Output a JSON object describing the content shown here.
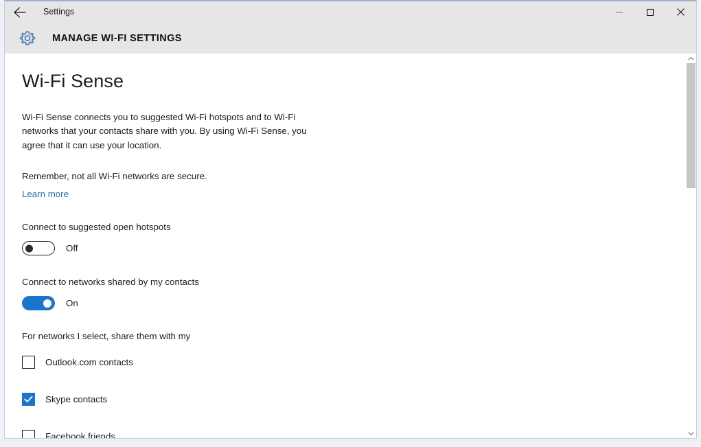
{
  "window": {
    "titlebar": {
      "back_icon": "back-arrow-icon",
      "title": "Settings",
      "minimize_label": "minimize-icon",
      "maximize_label": "maximize-icon",
      "close_label": "close-icon"
    },
    "header": {
      "icon": "gear-icon",
      "title": "MANAGE WI-FI SETTINGS"
    }
  },
  "main": {
    "page_title": "Wi-Fi Sense",
    "description": "Wi-Fi Sense connects you to suggested Wi-Fi hotspots and to Wi-Fi networks that your contacts share with you. By using Wi-Fi Sense, you agree that it can use your location.",
    "security_note": "Remember, not all Wi-Fi networks are secure.",
    "learn_more": "Learn more",
    "settings": [
      {
        "label": "Connect to suggested open hotspots",
        "state": "Off",
        "on": false
      },
      {
        "label": "Connect to networks shared by my contacts",
        "state": "On",
        "on": true
      }
    ],
    "share_section_label": "For networks I select, share them with my",
    "checkboxes": [
      {
        "label": "Outlook.com contacts",
        "checked": false
      },
      {
        "label": "Skype contacts",
        "checked": true
      },
      {
        "label": "Facebook friends",
        "checked": false
      }
    ]
  },
  "scrollbar": {
    "up_arrow": "chevron-up-icon",
    "down_arrow": "chevron-down-icon",
    "thumb_position_pct": 0,
    "thumb_size_pct": 34
  },
  "colors": {
    "accent": "#1d75c9",
    "link": "#2f6ea5",
    "chrome": "#e6e6e6",
    "text": "#1b1b1b",
    "scroll_thumb": "#c6c6c6"
  }
}
